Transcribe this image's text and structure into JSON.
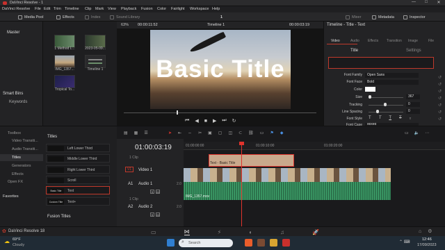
{
  "window": {
    "title": "DaVinci Resolve - 1",
    "controls": [
      "—",
      "□",
      "✕"
    ]
  },
  "menu": [
    "DaVinci Resolve",
    "File",
    "Edit",
    "Trim",
    "Timeline",
    "Clip",
    "Mark",
    "View",
    "Playback",
    "Fusion",
    "Color",
    "Fairlight",
    "Workspace",
    "Help"
  ],
  "toolbar": {
    "media_pool": "Media Pool",
    "effects": "Effects",
    "index": "Index",
    "sound_library": "Sound Library",
    "project_number": "1",
    "mixer": "Mixer",
    "metadata": "Metadata",
    "inspector": "Inspector"
  },
  "left": {
    "master": "Master",
    "smart_bins": "Smart Bins",
    "keywords": "Keywords"
  },
  "media_clips": [
    "1 Method L...",
    "2023-05-09...",
    "IMG_1357...",
    "Timeline 1",
    "Tropical To..."
  ],
  "viewer": {
    "zoom": "63%",
    "timecode_left": "00:00:11:52",
    "timeline_name": "Timeline 1",
    "timecode_right": "00:00:03:19",
    "overlay_text": "Basic Title"
  },
  "inspector": {
    "header": "Timeline - Title - Text",
    "tabs": [
      "Video",
      "Audio",
      "Effects",
      "Transition",
      "Image",
      "File"
    ],
    "subtabs": [
      "Title",
      "Settings"
    ],
    "font_family_label": "Font Family",
    "font_family": "Open Sans",
    "font_face_label": "Font Face",
    "font_face": "Bold",
    "color_label": "Color",
    "color_value": "#ffffff",
    "size_label": "Size",
    "size": "367",
    "tracking_label": "Tracking",
    "tracking": "0",
    "line_spacing_label": "Line Spacing",
    "line_spacing": "0",
    "font_style_label": "Font Style",
    "font_style_glyphs": [
      "T",
      "T",
      "T",
      "T",
      "T"
    ],
    "font_case_label": "Font Case",
    "font_case": "Mixed"
  },
  "toolbox": {
    "items": [
      "Toolbox",
      "Video Transiti...",
      "Audio Transiti...",
      "Titles",
      "Generators",
      "Effects",
      "Open FX",
      "Favorites"
    ],
    "header": "Titles",
    "fusion_header": "Fusion Titles",
    "titles": [
      {
        "thumb": "",
        "name": "Left Lower Third"
      },
      {
        "thumb": "",
        "name": "Middle Lower Third"
      },
      {
        "thumb": "",
        "name": "Right Lower Third"
      },
      {
        "thumb": "",
        "name": "Scroll"
      },
      {
        "thumb": "Basic Title",
        "name": "Text"
      },
      {
        "thumb": "Custom Title",
        "name": "Text+"
      }
    ]
  },
  "timeline": {
    "timecode": "01:00:03:19",
    "ruler": [
      "01:00:00:00",
      "01:00:10:00",
      "01:00:20:00"
    ],
    "tracks": [
      {
        "id": "V1",
        "name": "Video 1",
        "info": "1 Clip"
      },
      {
        "id": "A1",
        "name": "Audio 1",
        "level": "2.0",
        "info": "1 Clip"
      },
      {
        "id": "A2",
        "name": "Audio 2",
        "level": "2.0"
      }
    ],
    "title_clip": "Text - Basic Title",
    "audio_clip": "IMG_1357.mov"
  },
  "footer": {
    "app_name": "DaVinci Resolve 18"
  },
  "taskbar": {
    "weather_temp": "69°F",
    "weather_desc": "Cloudy",
    "search_placeholder": "Search",
    "time": "12:46",
    "date": "17/09/2023"
  },
  "colors": {
    "accent_red": "#c0392b",
    "title_clip": "#c9a98c",
    "audio_green": "#2f7e53",
    "playhead": "#e0332c"
  }
}
